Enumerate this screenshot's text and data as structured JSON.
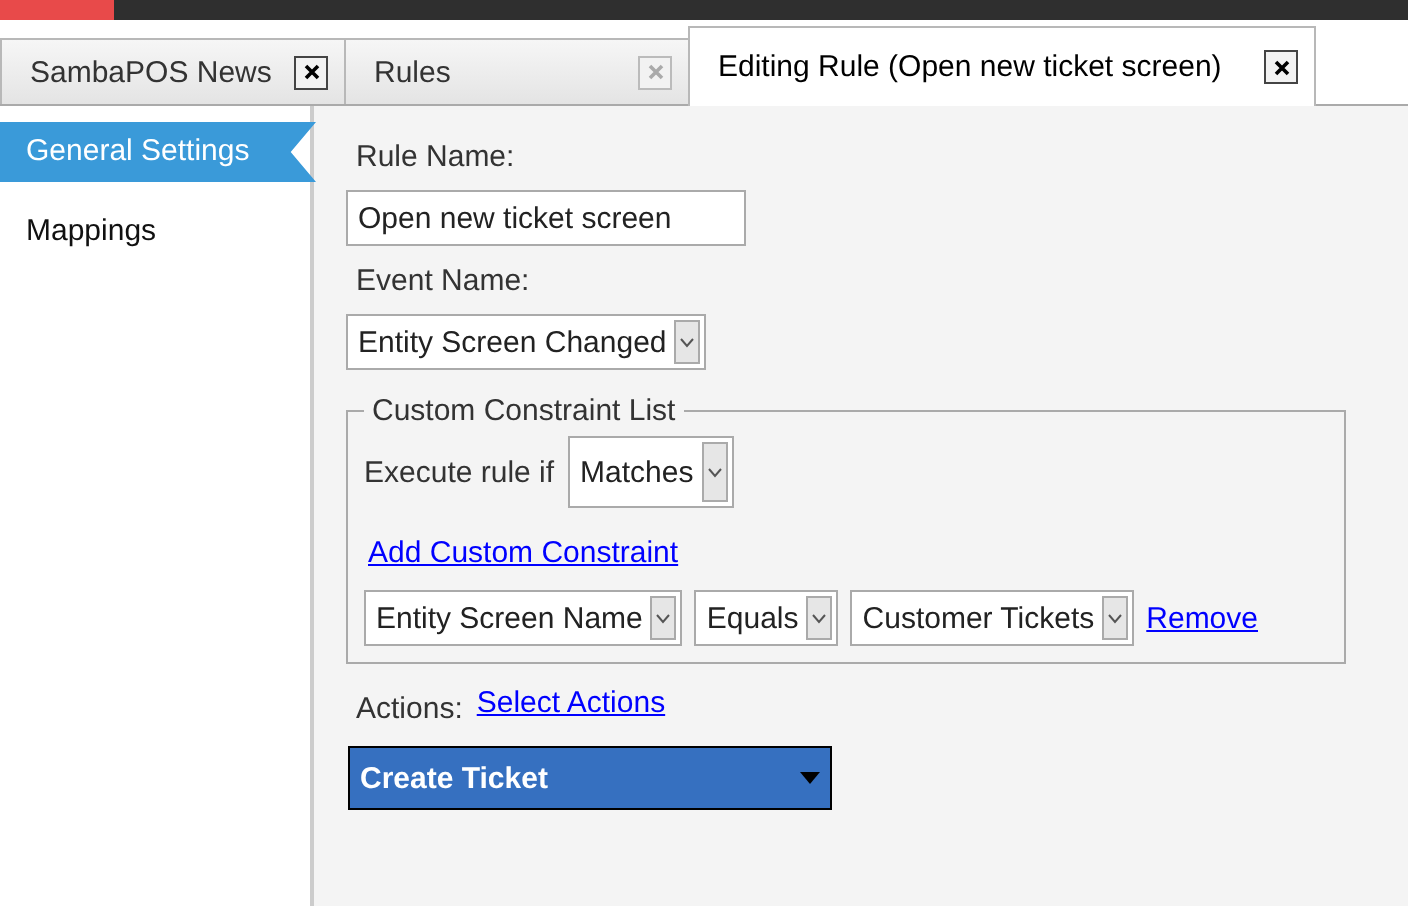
{
  "tabs": [
    {
      "label": "SambaPOS News",
      "selected": false,
      "close_enabled": true
    },
    {
      "label": "Rules",
      "selected": false,
      "close_enabled": false
    },
    {
      "label": "Editing Rule (Open new ticket screen)",
      "selected": true,
      "close_enabled": true
    }
  ],
  "sidebar": {
    "items": [
      {
        "label": "General Settings",
        "selected": true
      },
      {
        "label": "Mappings",
        "selected": false
      }
    ]
  },
  "form": {
    "rule_name_label": "Rule Name:",
    "rule_name_value": "Open new ticket screen",
    "event_name_label": "Event Name:",
    "event_name_value": "Entity Screen Changed",
    "constraint_group": {
      "title": "Custom Constraint List",
      "execute_label": "Execute rule if",
      "execute_value": "Matches",
      "add_link": "Add Custom Constraint",
      "constraints": [
        {
          "field": "Entity Screen Name",
          "operator": "Equals",
          "value": "Customer Tickets",
          "remove_link": "Remove"
        }
      ]
    },
    "actions_label": "Actions:",
    "select_actions_link": "Select Actions",
    "actions": [
      {
        "label": "Create Ticket"
      }
    ]
  }
}
